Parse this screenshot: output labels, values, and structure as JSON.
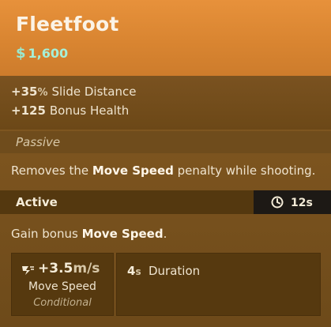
{
  "item": {
    "name": "Fleetfoot",
    "price_symbol": "$",
    "price": "1,600"
  },
  "stats": [
    {
      "value": "+35",
      "unit": "%",
      "label": "Slide Distance"
    },
    {
      "value": "+125",
      "unit": "",
      "label": "Bonus Health"
    }
  ],
  "passive": {
    "header": "Passive",
    "text_before": "Removes the ",
    "text_bold": "Move Speed",
    "text_after": " penalty while shooting."
  },
  "active": {
    "header": "Active",
    "cooldown": "12s",
    "cooldown_icon": "cooldown-icon",
    "text_before": "Gain bonus ",
    "text_bold": "Move Speed",
    "text_after": "."
  },
  "move_speed_box": {
    "icon": "move-speed-icon",
    "value": "+3.5",
    "unit": "m/s",
    "label": "Move Speed",
    "condition": "Conditional"
  },
  "duration_box": {
    "value": "4",
    "unit": "s",
    "label": "Duration"
  },
  "colors": {
    "header_orange": "#e7913b",
    "price_green": "#a5f0d8",
    "body_brown": "#7a5220",
    "cooldown_bg": "#1d1915"
  }
}
